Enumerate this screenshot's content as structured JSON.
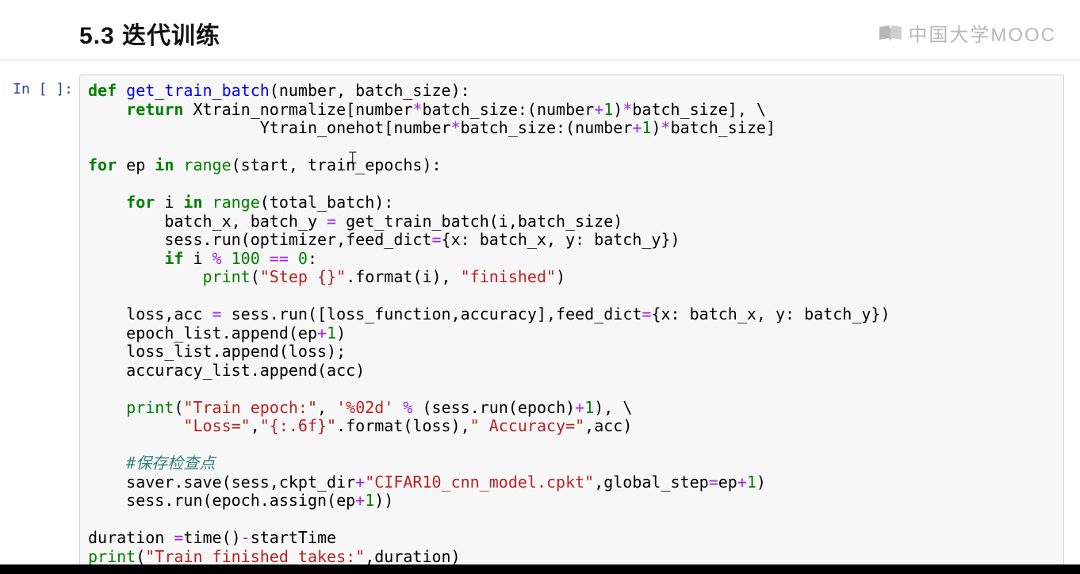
{
  "header": {
    "section_title": "5.3  迭代训练",
    "watermark_text": "中国大学MOOC"
  },
  "cell": {
    "prompt": "In [ ]:"
  },
  "code": {
    "l1": {
      "kw_def": "def",
      "fname": "get_train_batch",
      "tail": "(number, batch_size):"
    },
    "l2": {
      "kw_return": "return",
      "part1": " Xtrain_normalize[number",
      "op1": "*",
      "part2": "batch_size:(number",
      "op2": "+",
      "num1": "1",
      "part3": ")",
      "op3": "*",
      "part4": "batch_size], \\"
    },
    "l3": {
      "part1": "Ytrain_onehot[number",
      "op1": "*",
      "part2": "batch_size:(number",
      "op2": "+",
      "num1": "1",
      "part3": ")",
      "op3": "*",
      "part4": "batch_size]"
    },
    "l4": {
      "kw_for": "for",
      "var": " ep ",
      "kw_in": "in",
      "fn_range": " range",
      "tail": "(start, train_epochs):"
    },
    "l5": {
      "kw_for": "for",
      "var": " i ",
      "kw_in": "in",
      "fn_range": " range",
      "tail": "(total_batch):"
    },
    "l6": {
      "part1": "batch_x, batch_y ",
      "op1": "=",
      "part2": " get_train_batch(i,batch_size)"
    },
    "l7": {
      "part1": "sess.run(optimizer,feed_dict",
      "op1": "=",
      "part2": "{x: batch_x, y: batch_y})"
    },
    "l8": {
      "kw_if": "if",
      "part1": " i ",
      "op1": "%",
      "num1": " 100",
      "op2": " ==",
      "num2": " 0",
      "tail": ":"
    },
    "l9": {
      "fn_print": "print",
      "p1": "(",
      "s1": "\"Step {}\"",
      "part1": ".format(i), ",
      "s2": "\"finished\"",
      "p2": ")"
    },
    "l10": {
      "part1": "loss,acc ",
      "op1": "=",
      "part2": " sess.run([loss_function,accuracy],feed_dict",
      "op2": "=",
      "part3": "{x: batch_x, y: batch_y})"
    },
    "l11": {
      "part1": "epoch_list.append(ep",
      "op1": "+",
      "num1": "1",
      "part2": ")"
    },
    "l12": {
      "text": "loss_list.append(loss);"
    },
    "l13": {
      "text": "accuracy_list.append(acc)"
    },
    "l14": {
      "fn_print": "print",
      "p1": "(",
      "s1": "\"Train epoch:\"",
      "c1": ", ",
      "s2": "'%02d'",
      "op1": " %",
      "part1": " (sess.run(epoch)",
      "op2": "+",
      "num1": "1",
      "part2": "), \\"
    },
    "l15": {
      "s1": "\"Loss=\"",
      "c1": ",",
      "s2": "\"{:.6f}\"",
      "part1": ".format(loss),",
      "s3": "\" Accuracy=\"",
      "part2": ",acc)"
    },
    "l16": {
      "comment": "#保存检查点"
    },
    "l17": {
      "part1": "saver.save(sess,ckpt_dir",
      "op1": "+",
      "s1": "\"CIFAR10_cnn_model.cpkt\"",
      "part2": ",global_step",
      "op2": "=",
      "part3": "ep",
      "op3": "+",
      "num1": "1",
      "part4": ")"
    },
    "l18": {
      "part1": "sess.run(epoch.assign(ep",
      "op1": "+",
      "num1": "1",
      "part2": "))"
    },
    "l19": {
      "part1": "duration ",
      "op1": "=",
      "part2": "time()",
      "op2": "-",
      "part3": "startTime"
    },
    "l20": {
      "fn_print": "print",
      "p1": "(",
      "s1": "\"Train finished takes:\"",
      "part1": ",duration)"
    }
  }
}
